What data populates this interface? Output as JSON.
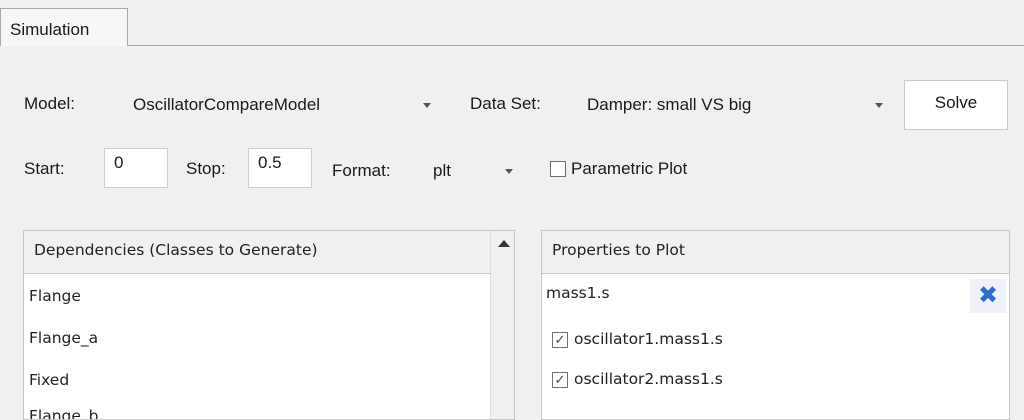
{
  "tabs": [
    {
      "label": "Simulation"
    }
  ],
  "simulation": {
    "model_label": "Model:",
    "model_value": "OscillatorCompareModel",
    "dataset_label": "Data Set:",
    "dataset_value": "Damper: small VS big",
    "solve_label": "Solve",
    "start_label": "Start:",
    "start_value": "0",
    "stop_label": "Stop:",
    "stop_value": "0.5",
    "format_label": "Format:",
    "format_value": "plt",
    "parametric_label": "Parametric Plot",
    "parametric_checked": false
  },
  "dependencies": {
    "header": "Dependencies (Classes to Generate)",
    "items": [
      "Flange",
      "Flange_a",
      "Fixed",
      "Flange_b"
    ]
  },
  "properties": {
    "header": "Properties to Plot",
    "input_value": "mass1.s",
    "delete_icon": "close-icon",
    "items": [
      {
        "label": "oscillator1.mass1.s",
        "checked": true
      },
      {
        "label": "oscillator2.mass1.s",
        "checked": true
      }
    ]
  },
  "colors": {
    "accent": "#2f6ec4",
    "background": "#f0f0f0"
  }
}
